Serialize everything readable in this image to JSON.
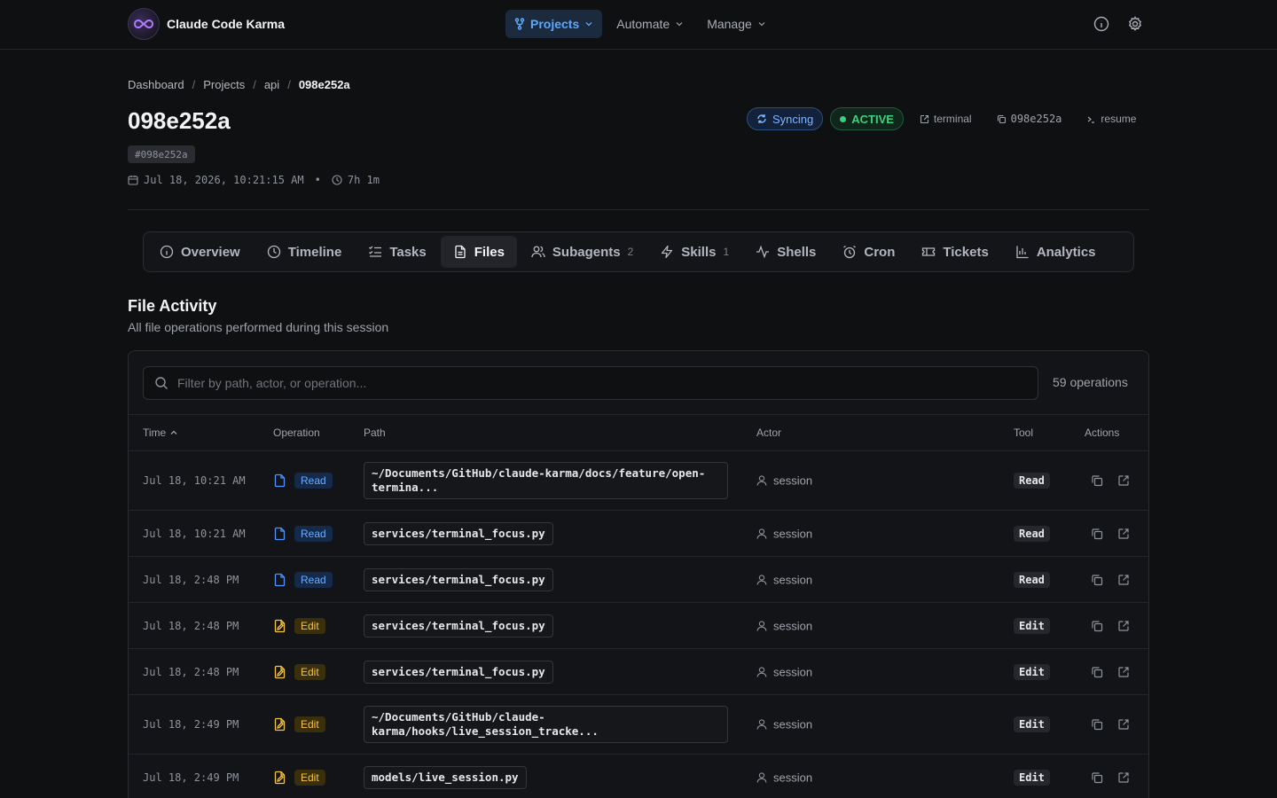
{
  "app": {
    "name": "Claude Code Karma"
  },
  "nav": {
    "items": [
      {
        "label": "Projects",
        "active": true
      },
      {
        "label": "Automate",
        "active": false
      },
      {
        "label": "Manage",
        "active": false
      }
    ]
  },
  "breadcrumb": [
    "Dashboard",
    "Projects",
    "api",
    "098e252a"
  ],
  "session": {
    "title": "098e252a",
    "id_chip": "#098e252a",
    "started": "Jul 18, 2026, 10:21:15 AM",
    "duration": "7h 1m",
    "sync_label": "Syncing",
    "status_label": "ACTIVE",
    "terminal_label": "terminal",
    "copy_id_label": "098e252a",
    "resume_label": "resume"
  },
  "tabs": [
    {
      "label": "Overview",
      "count": "",
      "icon": "info-icon"
    },
    {
      "label": "Timeline",
      "count": "",
      "icon": "clock-icon"
    },
    {
      "label": "Tasks",
      "count": "",
      "icon": "list-checks-icon"
    },
    {
      "label": "Files",
      "count": "",
      "icon": "file-icon",
      "active": true
    },
    {
      "label": "Subagents",
      "count": "2",
      "icon": "users-icon"
    },
    {
      "label": "Skills",
      "count": "1",
      "icon": "zap-icon"
    },
    {
      "label": "Shells",
      "count": "",
      "icon": "activity-icon"
    },
    {
      "label": "Cron",
      "count": "",
      "icon": "alarm-icon"
    },
    {
      "label": "Tickets",
      "count": "",
      "icon": "ticket-icon"
    },
    {
      "label": "Analytics",
      "count": "",
      "icon": "bar-chart-icon"
    }
  ],
  "section": {
    "title": "File Activity",
    "subtitle": "All file operations performed during this session"
  },
  "filter": {
    "placeholder": "Filter by path, actor, or operation...",
    "count_label": "59 operations"
  },
  "table": {
    "headers": {
      "time": "Time",
      "operation": "Operation",
      "path": "Path",
      "actor": "Actor",
      "tool": "Tool",
      "actions": "Actions"
    },
    "rows": [
      {
        "time": "Jul 18, 10:21 AM",
        "op": "Read",
        "path": "~/Documents/GitHub/claude-karma/docs/feature/open-termina...",
        "actor": "session",
        "tool": "Read"
      },
      {
        "time": "Jul 18, 10:21 AM",
        "op": "Read",
        "path": "services/terminal_focus.py",
        "actor": "session",
        "tool": "Read"
      },
      {
        "time": "Jul 18, 2:48 PM",
        "op": "Read",
        "path": "services/terminal_focus.py",
        "actor": "session",
        "tool": "Read"
      },
      {
        "time": "Jul 18, 2:48 PM",
        "op": "Edit",
        "path": "services/terminal_focus.py",
        "actor": "session",
        "tool": "Edit"
      },
      {
        "time": "Jul 18, 2:48 PM",
        "op": "Edit",
        "path": "services/terminal_focus.py",
        "actor": "session",
        "tool": "Edit"
      },
      {
        "time": "Jul 18, 2:49 PM",
        "op": "Edit",
        "path": "~/Documents/GitHub/claude-karma/hooks/live_session_tracke...",
        "actor": "session",
        "tool": "Edit"
      },
      {
        "time": "Jul 18, 2:49 PM",
        "op": "Edit",
        "path": "models/live_session.py",
        "actor": "session",
        "tool": "Edit"
      }
    ]
  }
}
